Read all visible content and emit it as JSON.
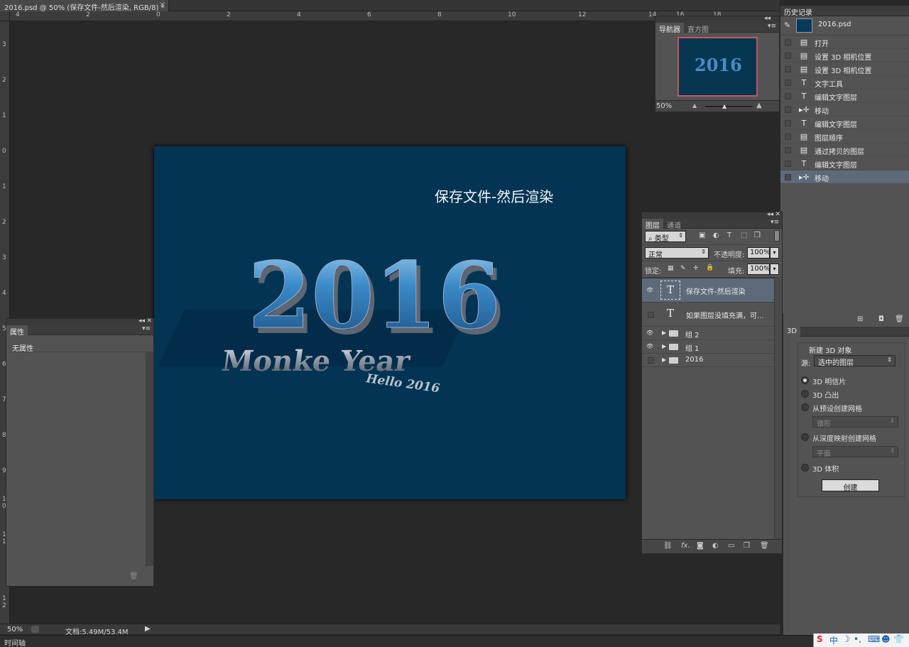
{
  "document": {
    "tab_title": "2016.psd @ 50% (保存文件-然后渲染, RGB/8) *",
    "tab_close": "×",
    "canvas_text": "保存文件-然后渲染"
  },
  "rulers": {
    "top": [
      "4",
      "2",
      "0",
      "2",
      "4",
      "6",
      "8",
      "10",
      "12",
      "14",
      "16",
      "18"
    ],
    "left": [
      "3",
      "2",
      "1",
      "0",
      "1",
      "2",
      "3",
      "4",
      "5",
      "6",
      "7",
      "8",
      "9",
      "1 0",
      "1 1",
      "1 2"
    ]
  },
  "status": {
    "zoom": "50%",
    "doc_size": "文档:5.49M/53.4M",
    "arrow": "▶"
  },
  "timeline": {
    "label": "时间轴"
  },
  "navigator": {
    "tabs": [
      "导航器",
      "直方图"
    ],
    "zoom": "50%"
  },
  "history": {
    "tab": "历史记录",
    "snapshot_name": "2016.psd",
    "items": [
      {
        "icon": "document-icon",
        "glyph": "▤",
        "label": "打开",
        "active": false
      },
      {
        "icon": "document-icon",
        "glyph": "▤",
        "label": "设置 3D 相机位置",
        "active": false
      },
      {
        "icon": "document-icon",
        "glyph": "▤",
        "label": "设置 3D 相机位置",
        "active": false
      },
      {
        "icon": "text-tool-icon",
        "glyph": "T",
        "label": "文字工具",
        "active": false
      },
      {
        "icon": "text-tool-icon",
        "glyph": "T",
        "label": "编辑文字图层",
        "active": false
      },
      {
        "icon": "move-tool-icon",
        "glyph": "▸✛",
        "label": "移动",
        "active": false
      },
      {
        "icon": "text-tool-icon",
        "glyph": "T",
        "label": "编辑文字图层",
        "active": false
      },
      {
        "icon": "document-icon",
        "glyph": "▤",
        "label": "图层顺序",
        "active": false
      },
      {
        "icon": "document-icon",
        "glyph": "▤",
        "label": "通过拷贝的图层",
        "active": false
      },
      {
        "icon": "text-tool-icon",
        "glyph": "T",
        "label": "编辑文字图层",
        "active": false
      },
      {
        "icon": "move-tool-icon",
        "glyph": "▸✛",
        "label": "移动",
        "active": true
      }
    ]
  },
  "layers": {
    "tabs": [
      "图层",
      "通道"
    ],
    "filter_kind": "类型",
    "blend_mode": "正常",
    "opacity_label": "不透明度:",
    "opacity": "100%",
    "lock_label": "锁定:",
    "fill_label": "填充:",
    "fill": "100%",
    "rows": [
      {
        "type": "text",
        "name": "保存文件-然后渲染",
        "visible": true,
        "active": true
      },
      {
        "type": "text",
        "name": "如果图层没填充满，可...",
        "visible": false,
        "active": false
      },
      {
        "type": "group",
        "name": "组 2",
        "visible": true,
        "active": false
      },
      {
        "type": "group",
        "name": "组 1",
        "visible": true,
        "active": false
      },
      {
        "type": "group",
        "name": "2016",
        "visible": false,
        "active": false
      }
    ]
  },
  "properties": {
    "tab": "属性",
    "content": "无属性"
  },
  "three_d": {
    "tab": "3D",
    "heading": "新建 3D 对象",
    "source_label": "源:",
    "source_value": "选中的图层",
    "options": [
      {
        "label": "3D 明信片",
        "selected": true
      },
      {
        "label": "3D 凸出",
        "selected": false
      },
      {
        "label": "从预设创建网格",
        "selected": false
      },
      {
        "label": "从深度映射创建网格",
        "selected": false
      },
      {
        "label": "3D 体积",
        "selected": false
      }
    ],
    "preset_value": "锥形",
    "depth_value": "平面",
    "create_button": "创建"
  },
  "artwork": {
    "big_text": "2016",
    "sub_text": "Monke Year",
    "small_text": "Hello 2016"
  },
  "tray": {
    "ime": "中"
  }
}
